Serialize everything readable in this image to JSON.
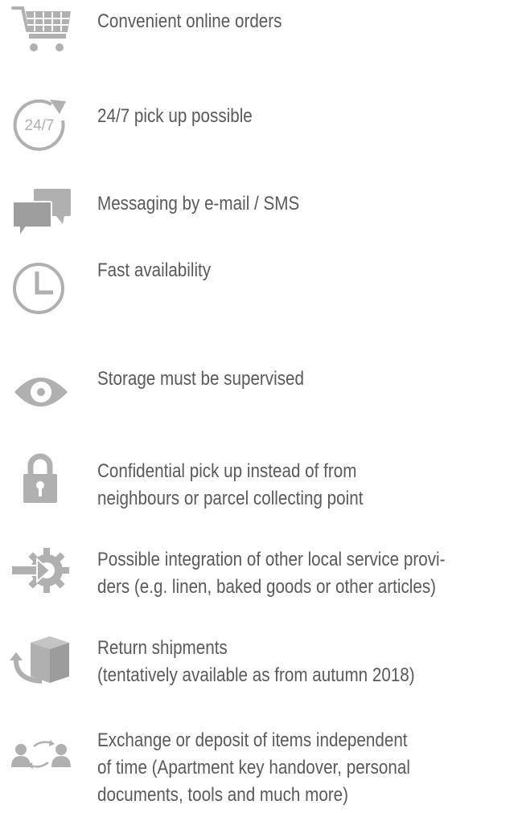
{
  "colors": {
    "icon": "#b0b0b0",
    "text": "#5a5a5a",
    "background": "#ffffff"
  },
  "features": [
    {
      "icon": "shopping-cart-icon",
      "lines": [
        "Convenient online orders"
      ]
    },
    {
      "icon": "24-7-clock-icon",
      "icon_text": "24/7",
      "lines": [
        "24/7 pick up possible"
      ]
    },
    {
      "icon": "chat-bubbles-icon",
      "lines": [
        "Messaging by e-mail / SMS"
      ]
    },
    {
      "icon": "clock-icon",
      "lines": [
        "Fast availability"
      ]
    },
    {
      "icon": "eye-icon",
      "lines": [
        "Storage must be supervised"
      ]
    },
    {
      "icon": "padlock-icon",
      "lines": [
        "Confidential pick up instead of from",
        "neighbours or parcel collecting point"
      ]
    },
    {
      "icon": "integration-gear-icon",
      "lines": [
        "Possible integration of other local service provi-",
        "ders (e.g. linen, baked goods or other articles)"
      ]
    },
    {
      "icon": "return-box-icon",
      "lines": [
        "Return shipments",
        "(tentatively available as from autumn 2018)"
      ]
    },
    {
      "icon": "people-exchange-icon",
      "lines": [
        "Exchange or deposit of items independent",
        "of time (Apartment key handover, personal",
        "documents, tools and much more)"
      ]
    }
  ]
}
